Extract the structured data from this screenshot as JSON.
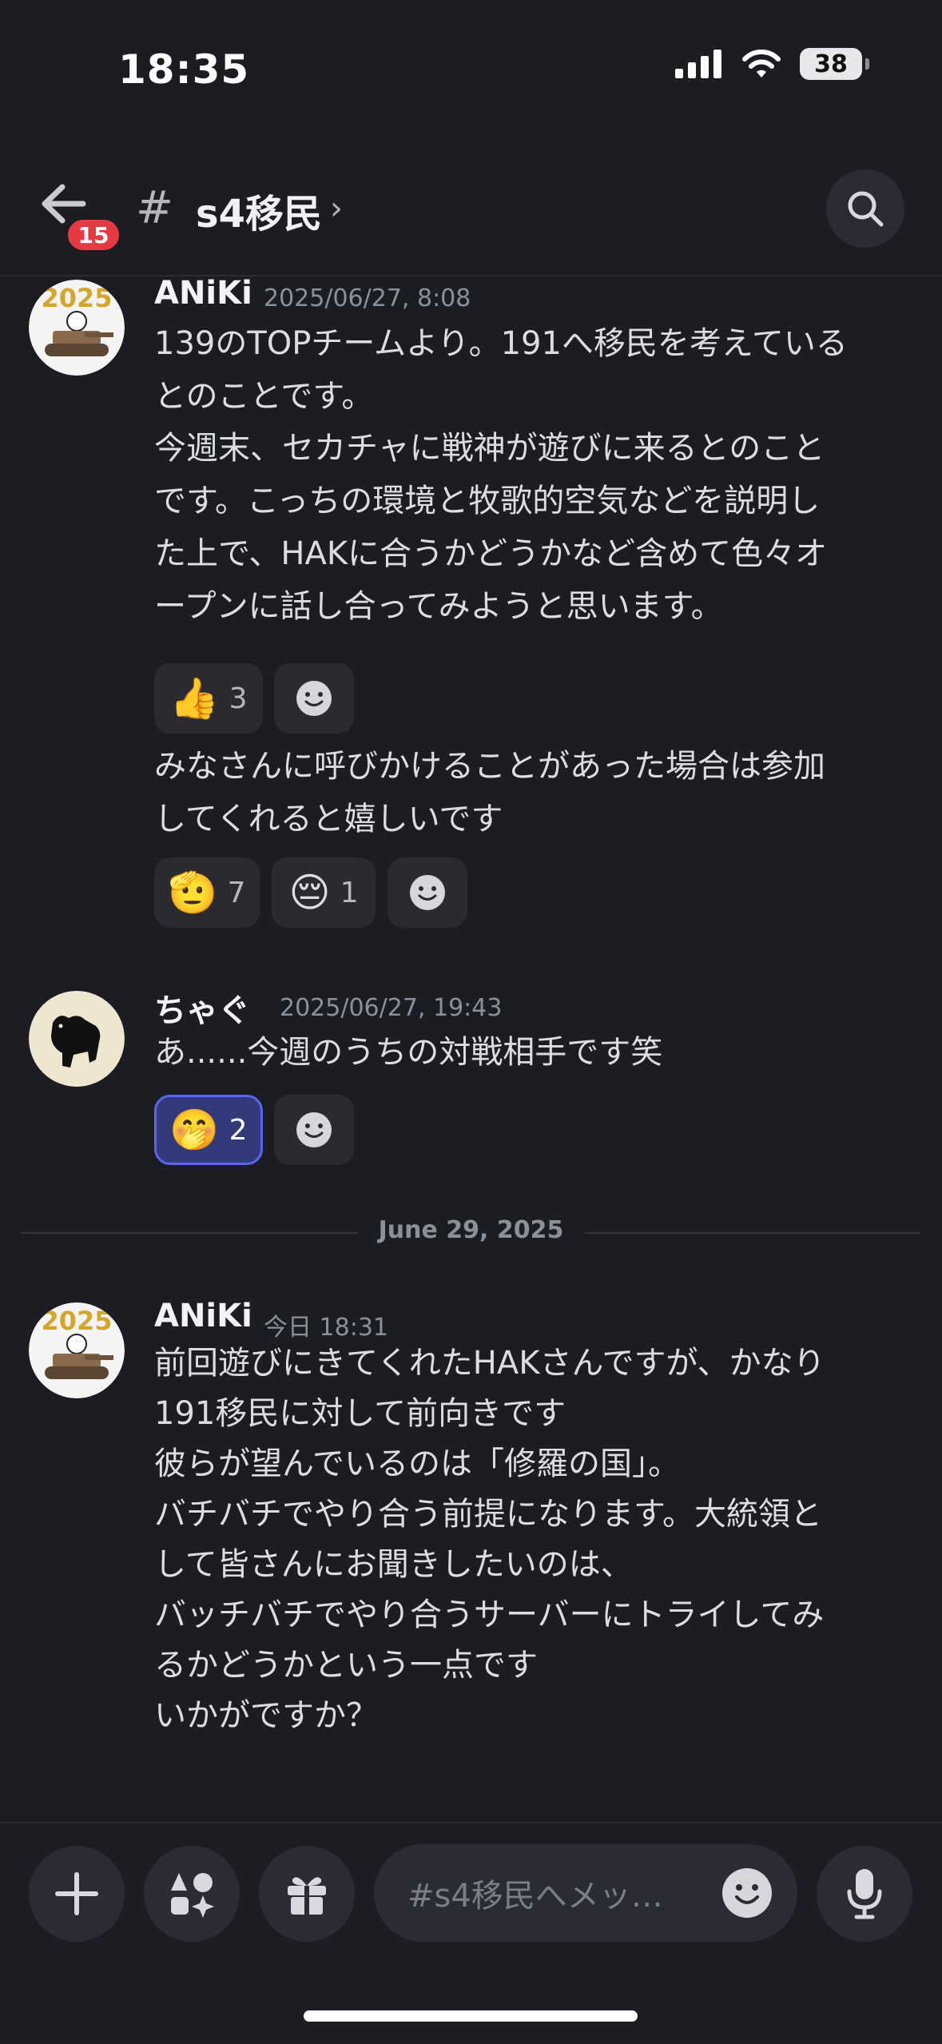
{
  "status": {
    "time": "18:35",
    "battery": "38"
  },
  "header": {
    "unread_badge": "15",
    "channel_name": "s4移民",
    "hash": "#",
    "chevron": "›"
  },
  "messages": [
    {
      "author": "ANiKi",
      "timestamp": "2025/06/27, 8:08",
      "avatar_text": "2025",
      "blocks": [
        "139のTOPチームより。191へ移民を考えている\nとのことです。",
        "今週末、セカチャに戦神が遊びに来るとのこと\nです。こっちの環境と牧歌的空気などを説明し\nた上で、HAKに合うかどうかなど含めて色々オ\nープンに話し合ってみようと思います。",
        "みなさんに呼びかけることがあった場合は参加\nしてくれると嬉しいです"
      ],
      "reactions_1": [
        {
          "emoji": "👍",
          "count": "3"
        }
      ],
      "reactions_2": [
        {
          "emoji": "🫡",
          "count": "7"
        },
        {
          "emoji": "😔",
          "count": "1"
        }
      ]
    },
    {
      "author": "ちゃぐ",
      "timestamp": "2025/06/27, 19:43",
      "text": "あ......今週のうちの対戦相手です笑",
      "reactions": [
        {
          "emoji": "🤭",
          "count": "2"
        }
      ]
    },
    {
      "author": "ANiKi",
      "timestamp": "今日 18:31",
      "avatar_text": "2025",
      "text": "前回遊びにきてくれたHAKさんですが、かなり\n191移民に対して前向きです\n彼らが望んでいるのは「修羅の国」。\nバチバチでやり合う前提になります。大統領と\nして皆さんにお聞きしたいのは、\nバッチバチでやり合うサーバーにトライしてみ\nるかどうかという一点です\nいかがですか？"
    }
  ],
  "date_separator": "June 29, 2025",
  "composer": {
    "placeholder": "#s4移民へメッ…"
  },
  "colors": {
    "accent": "#5865f2",
    "badge": "#e53a43",
    "background": "#1c1d23"
  }
}
